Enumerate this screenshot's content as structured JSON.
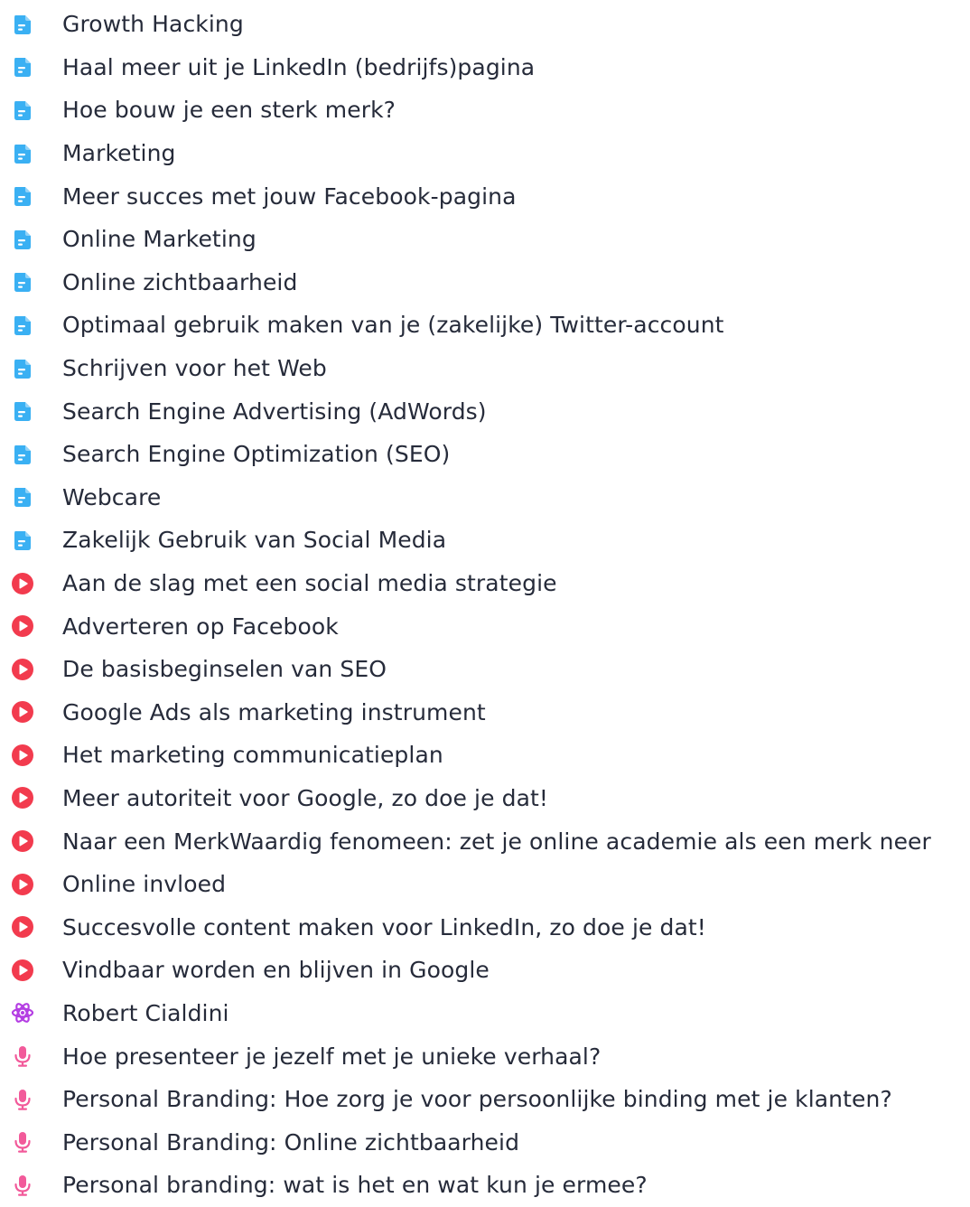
{
  "colors": {
    "document": "#3ab0f3",
    "video": "#f23b4e",
    "expert": "#b43ee3",
    "podcast": "#f25a9a",
    "text": "#262b3a"
  },
  "items": [
    {
      "label": "Growth Hacking",
      "type": "document",
      "icon": "document-icon"
    },
    {
      "label": "Haal meer uit je LinkedIn (bedrijfs)pagina",
      "type": "document",
      "icon": "document-icon"
    },
    {
      "label": "Hoe bouw je een sterk merk?",
      "type": "document",
      "icon": "document-icon"
    },
    {
      "label": "Marketing",
      "type": "document",
      "icon": "document-icon"
    },
    {
      "label": "Meer succes met jouw Facebook-pagina",
      "type": "document",
      "icon": "document-icon"
    },
    {
      "label": "Online Marketing",
      "type": "document",
      "icon": "document-icon"
    },
    {
      "label": "Online zichtbaarheid",
      "type": "document",
      "icon": "document-icon"
    },
    {
      "label": "Optimaal gebruik maken van je (zakelijke) Twitter-account",
      "type": "document",
      "icon": "document-icon"
    },
    {
      "label": "Schrijven voor het Web",
      "type": "document",
      "icon": "document-icon"
    },
    {
      "label": "Search Engine Advertising (AdWords)",
      "type": "document",
      "icon": "document-icon"
    },
    {
      "label": "Search Engine Optimization (SEO)",
      "type": "document",
      "icon": "document-icon"
    },
    {
      "label": "Webcare",
      "type": "document",
      "icon": "document-icon"
    },
    {
      "label": "Zakelijk Gebruik van Social Media",
      "type": "document",
      "icon": "document-icon"
    },
    {
      "label": "Aan de slag met een social media strategie",
      "type": "video",
      "icon": "play-icon"
    },
    {
      "label": "Adverteren op Facebook",
      "type": "video",
      "icon": "play-icon"
    },
    {
      "label": "De basisbeginselen van SEO",
      "type": "video",
      "icon": "play-icon"
    },
    {
      "label": "Google Ads als marketing instrument",
      "type": "video",
      "icon": "play-icon"
    },
    {
      "label": "Het marketing communicatieplan",
      "type": "video",
      "icon": "play-icon"
    },
    {
      "label": "Meer autoriteit voor Google, zo doe je dat!",
      "type": "video",
      "icon": "play-icon"
    },
    {
      "label": "Naar een MerkWaardig fenomeen: zet je online academie als een merk neer",
      "type": "video",
      "icon": "play-icon"
    },
    {
      "label": "Online invloed",
      "type": "video",
      "icon": "play-icon"
    },
    {
      "label": "Succesvolle content maken voor LinkedIn, zo doe je dat!",
      "type": "video",
      "icon": "play-icon"
    },
    {
      "label": "Vindbaar worden en blijven in Google",
      "type": "video",
      "icon": "play-icon"
    },
    {
      "label": "Robert Cialdini",
      "type": "expert",
      "icon": "atom-icon"
    },
    {
      "label": "Hoe presenteer je jezelf met je unieke verhaal?",
      "type": "podcast",
      "icon": "microphone-icon"
    },
    {
      "label": "Personal Branding: Hoe zorg je voor persoonlijke binding met je klanten?",
      "type": "podcast",
      "icon": "microphone-icon"
    },
    {
      "label": "Personal Branding: Online zichtbaarheid",
      "type": "podcast",
      "icon": "microphone-icon"
    },
    {
      "label": "Personal branding: wat is het en wat kun je ermee?",
      "type": "podcast",
      "icon": "microphone-icon"
    }
  ]
}
